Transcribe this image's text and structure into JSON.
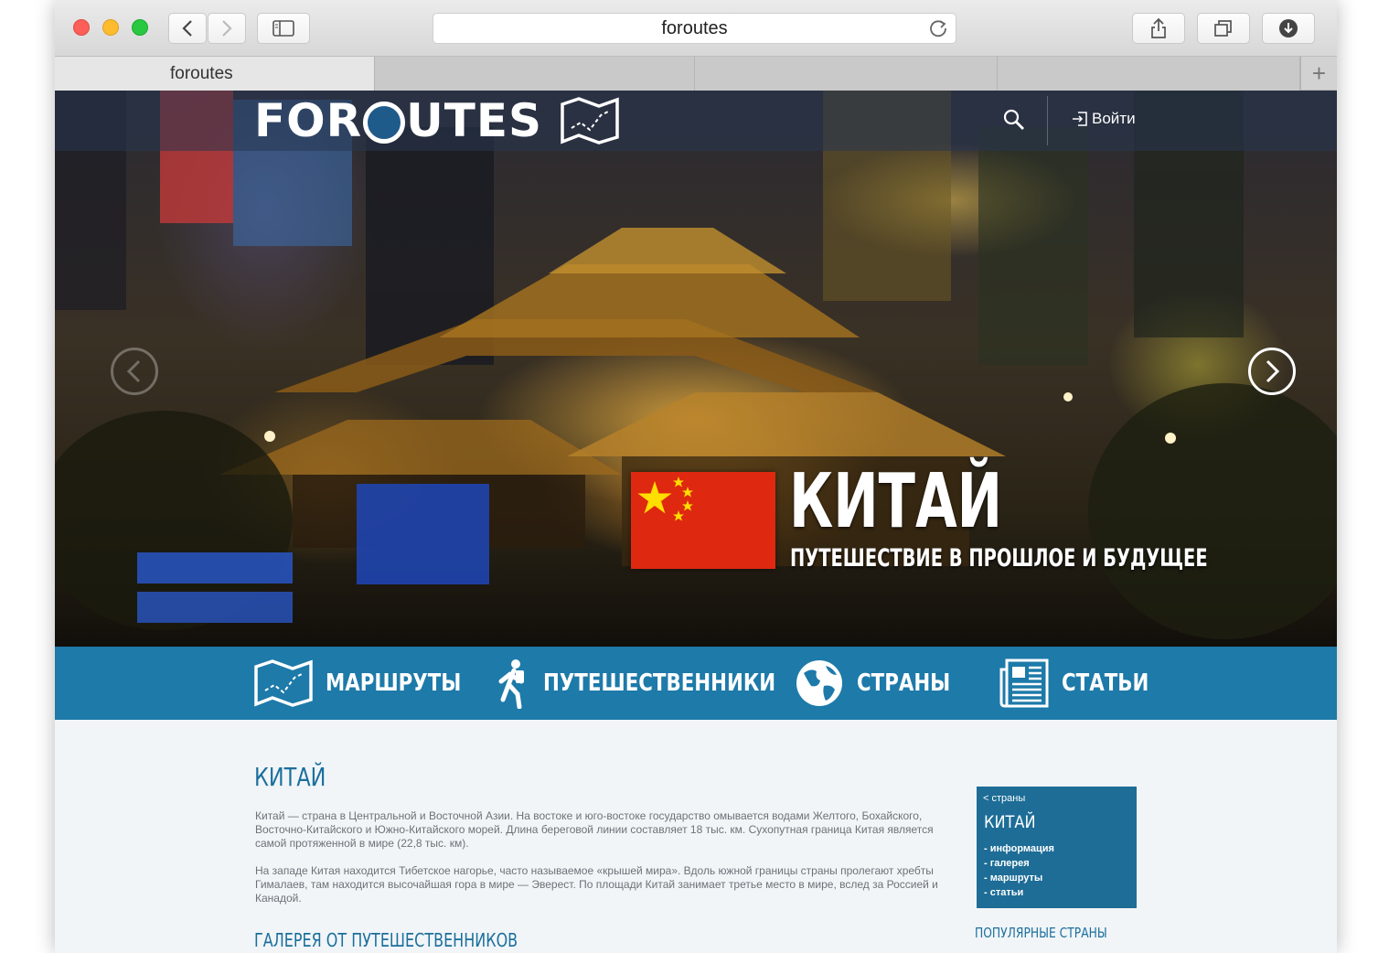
{
  "browser": {
    "url_text": "foroutes",
    "tab_title": "foroutes"
  },
  "header": {
    "logo_left": "FOR",
    "logo_right": "UTES",
    "login_label": "Войти"
  },
  "hero": {
    "title": "КИТАЙ",
    "subtitle": "ПУТЕШЕСТВИЕ В ПРОШЛОЕ И БУДУЩЕЕ"
  },
  "nav": {
    "items": [
      {
        "label": "МАРШРУТЫ",
        "icon": "map-route-icon"
      },
      {
        "label": "ПУТЕШЕСТВЕННИКИ",
        "icon": "hiker-icon"
      },
      {
        "label": "СТРАНЫ",
        "icon": "globe-icon"
      },
      {
        "label": "СТАТЬИ",
        "icon": "newspaper-icon"
      }
    ]
  },
  "content": {
    "title": "КИТАЙ",
    "paragraphs": [
      "Китай — страна в Центральной и Восточной Азии. На востоке и юго-востоке государство омывается водами Желтого, Бохайского, Восточно-Китайского и Южно-Китайского морей. Длина береговой линии составляет 18 тыс. км. Сухопутная граница Китая является самой протяженной в мире (22,8 тыс. км).",
      "На западе Китая находится Тибетское нагорье, часто называемое «крышей мира». Вдоль южной границы страны пролегают хребты Гималаев, там находится высочайшая гора в мире — Эверест. По площади Китай занимает третье место в мире, вслед за Россией и Канадой."
    ],
    "gallery_title": "ГАЛЕРЕЯ ОТ ПУТЕШЕСТВЕННИКОВ"
  },
  "sidebar": {
    "back_link": "< страны",
    "title": "КИТАЙ",
    "links": [
      "- информация",
      "- галерея",
      "- маршруты",
      "- статьи"
    ],
    "popular_title": "ПОПУЛЯРНЫЕ СТРАНЫ"
  },
  "colors": {
    "brand_blue": "#1d7aa9",
    "flag_red": "#de2910",
    "flag_star": "#ffde00"
  }
}
